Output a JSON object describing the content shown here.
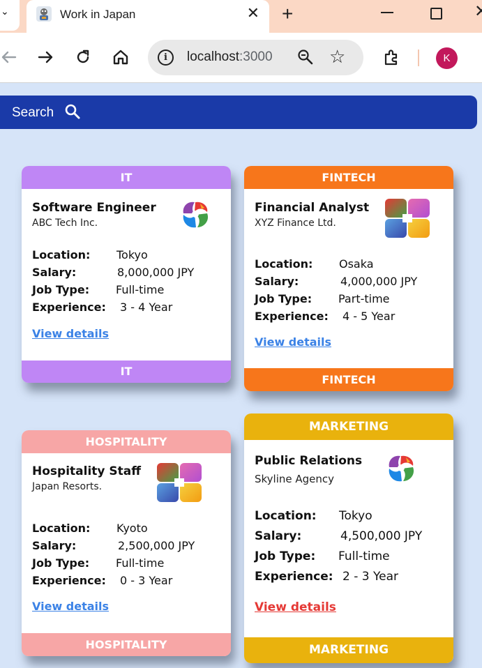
{
  "browser": {
    "tab_title": "Work in Japan",
    "url_host": "localhost",
    "url_port": ":3000",
    "avatar_letter": "K",
    "accent": "#fbd8c5"
  },
  "search": {
    "label": "Search"
  },
  "labels": {
    "location": "Location:",
    "salary": "Salary:",
    "job_type": "Job Type:",
    "experience": "Experience:",
    "view_details": "View details"
  },
  "jobs": [
    {
      "category": "IT",
      "color": "#bf86f5",
      "title": "Software Engineer",
      "company": "ABC Tech Inc.",
      "logo": "swirl-logo",
      "location": "Tokyo",
      "salary": "8,000,000 JPY",
      "job_type": "Full-time",
      "experience": "3 - 4 Year",
      "link_color": "#3b82e6"
    },
    {
      "category": "FINTECH",
      "color": "#f7761b",
      "title": "Financial Analyst",
      "company": "XYZ Finance Ltd.",
      "logo": "square-logo",
      "location": "Osaka",
      "salary": "4,000,000 JPY",
      "job_type": "Part-time",
      "experience": "4 - 5 Year",
      "link_color": "#3b82e6"
    },
    {
      "category": "HOSPITALITY",
      "color": "#f7a6a6",
      "title": "Hospitality Staff",
      "company": "Japan Resorts.",
      "logo": "square-logo",
      "location": "Kyoto",
      "salary": "2,500,000 JPY",
      "job_type": "Full-time",
      "experience": "0 - 3 Year",
      "link_color": "#3b82e6"
    },
    {
      "category": "MARKETING",
      "color": "#e9b20d",
      "title": "Public Relations",
      "company": "Skyline Agency",
      "logo": "swirl-logo",
      "location": "Tokyo",
      "salary": "4,500,000 JPY",
      "job_type": "Full-time",
      "experience": "2 - 3 Year",
      "link_color": "#e53935"
    }
  ]
}
